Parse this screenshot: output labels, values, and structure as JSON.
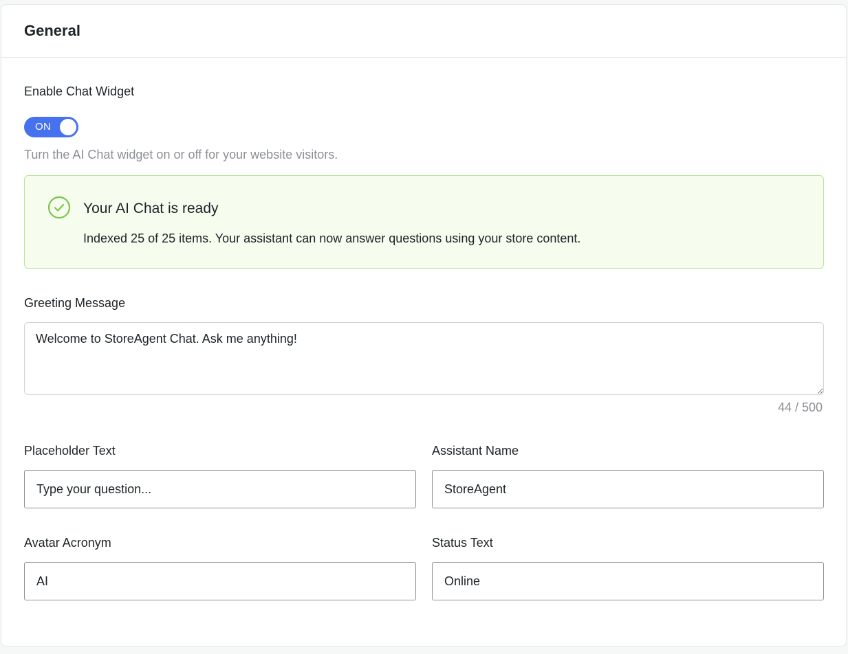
{
  "section": {
    "title": "General"
  },
  "enable_widget": {
    "label": "Enable Chat Widget",
    "toggle_label": "ON",
    "toggle_on": true,
    "help": "Turn the AI Chat widget on or off for your website visitors."
  },
  "notice": {
    "title": "Your AI Chat is ready",
    "text": "Indexed 25 of 25 items. Your assistant can now answer questions using your store content.",
    "icon": "check-circle-icon",
    "color": "#7cc44a"
  },
  "greeting": {
    "label": "Greeting Message",
    "value": "Welcome to StoreAgent Chat. Ask me anything!",
    "counter": "44 / 500"
  },
  "fields": {
    "placeholder_text": {
      "label": "Placeholder Text",
      "value": "Type your question..."
    },
    "assistant_name": {
      "label": "Assistant Name",
      "value": "StoreAgent"
    },
    "avatar_acronym": {
      "label": "Avatar Acronym",
      "value": "AI"
    },
    "status_text": {
      "label": "Status Text",
      "value": "Online"
    }
  },
  "colors": {
    "accent": "#4672f0",
    "success_border": "#b8e49a",
    "success_bg": "#f6fdee"
  }
}
